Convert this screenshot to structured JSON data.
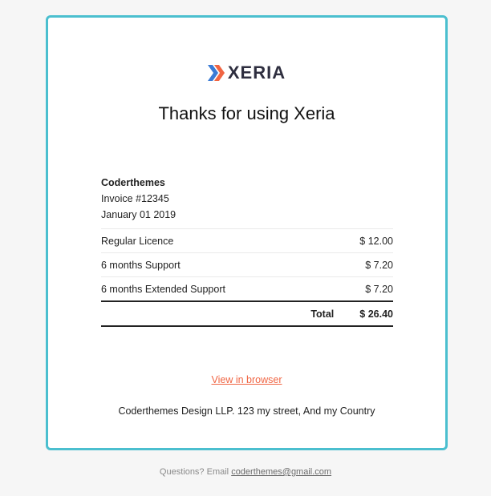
{
  "brand": {
    "name": "XERIA",
    "colors": {
      "accent_border": "#4bbfcf",
      "logo_orange": "#f06543",
      "logo_blue": "#3a7bd5",
      "link": "#f06543"
    }
  },
  "headline": "Thanks for using Xeria",
  "invoice": {
    "company": "Coderthemes",
    "number": "Invoice #12345",
    "date": "January 01 2019",
    "items": [
      {
        "name": "Regular Licence",
        "price": "$ 12.00"
      },
      {
        "name": "6 months Support",
        "price": "$ 7.20"
      },
      {
        "name": "6 months Extended Support",
        "price": "$ 7.20"
      }
    ],
    "total_label": "Total",
    "total_value": "$ 26.40"
  },
  "view_in_browser": "View in browser",
  "address": "Coderthemes Design LLP. 123 my street, And my Country",
  "footer": {
    "prefix": "Questions? Email",
    "email": "coderthemes@gmail.com"
  }
}
